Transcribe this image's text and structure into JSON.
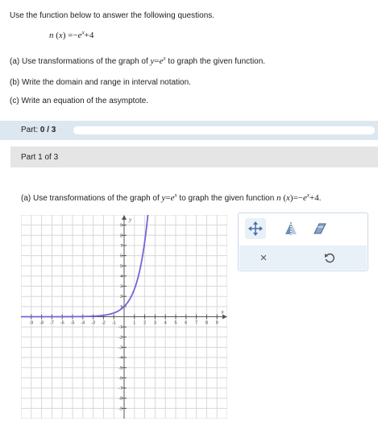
{
  "intro": "Use the function below to answer the following questions.",
  "function_lhs": "n",
  "function_arg": "x",
  "equals": "=",
  "neg": "−",
  "base": "e",
  "exponent": "x",
  "plus_const": "+4",
  "q_a": "(a) Use transformations of the graph of",
  "q_a_tail": "to graph the given function.",
  "q_b": "(b) Write the domain and range in interval notation.",
  "q_c": "(c) Write an equation of the asymptote.",
  "progress": {
    "label": "Part:",
    "value": "0 / 3",
    "fraction": 0
  },
  "part_label": "Part 1 of 3",
  "part_q_prefix": "(a) Use transformations of the graph of",
  "part_q_mid": "to graph the given function",
  "y_var": "y",
  "period": ".",
  "graph": {
    "x_axis_label": "x",
    "y_axis_label": "y",
    "x_ticks_neg": [
      "-9",
      "-8",
      "-7",
      "-6",
      "-5",
      "-4",
      "-3",
      "-2",
      "-1"
    ],
    "x_ticks_pos": [
      "1",
      "2",
      "3",
      "4",
      "5",
      "6",
      "7",
      "8",
      "9"
    ],
    "y_ticks_pos": [
      "9",
      "8",
      "7",
      "6",
      "5",
      "4",
      "3",
      "2",
      "1"
    ],
    "y_ticks_neg": [
      "-1",
      "-2",
      "-3",
      "-4",
      "-5",
      "-6",
      "-7",
      "-8",
      "-9"
    ],
    "xlim": [
      -10,
      10
    ],
    "ylim": [
      -10,
      10
    ],
    "curve": "y = e^x",
    "curve_color": "#6f66d6"
  },
  "tools": {
    "move": "move-tool-icon",
    "reflect": "reflect-tool-icon",
    "eraser": "eraser-tool-icon",
    "clear": "×",
    "undo": "undo-icon"
  }
}
